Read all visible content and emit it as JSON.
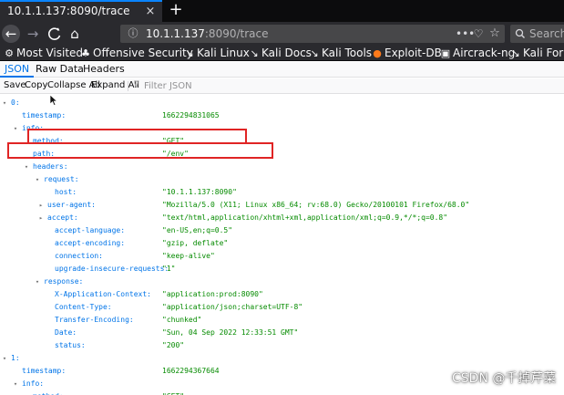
{
  "browser": {
    "tab_title": "10.1.1.137:8090/trace",
    "tab_close_glyph": "×",
    "new_tab_glyph": "+",
    "back_glyph": "←",
    "forward_glyph": "→",
    "reload_glyph": "C",
    "home_glyph": "⌂",
    "url_host": "10.1.1.137",
    "url_rest": ":8090/trace",
    "url_more_glyph": "•••",
    "url_pocket_glyph": "♡",
    "url_star_glyph": "☆",
    "search_placeholder": "Search",
    "accent": "#0a84ff"
  },
  "bookmarks": [
    {
      "label": "Most Visited",
      "icon": "gear-icon",
      "glyph": "⚙"
    },
    {
      "label": "Offensive Security",
      "icon": "offsec-icon",
      "glyph": "♣"
    },
    {
      "label": "Kali Linux",
      "icon": "kali-icon",
      "glyph": "↘"
    },
    {
      "label": "Kali Docs",
      "icon": "kali-icon",
      "glyph": "↘"
    },
    {
      "label": "Kali Tools",
      "icon": "kali-icon",
      "glyph": "↘"
    },
    {
      "label": "Exploit-DB",
      "icon": "exploitdb-icon",
      "glyph": "●"
    },
    {
      "label": "Aircrack-ng",
      "icon": "aircrack-icon",
      "glyph": "▣"
    },
    {
      "label": "Kali Foru",
      "icon": "kali-icon",
      "glyph": "↘"
    }
  ],
  "viewer": {
    "tabs": [
      "JSON",
      "Raw Data",
      "Headers"
    ],
    "toolbar": [
      "Save",
      "Copy",
      "Collapse All",
      "Expand All"
    ],
    "filter_glyph": "⊽",
    "filter_placeholder": "Filter JSON"
  },
  "json_rows": [
    {
      "twisty": "▾",
      "key": "0:",
      "value": ""
    },
    {
      "twisty": "",
      "key": "timestamp:",
      "value": "1662294831065"
    },
    {
      "twisty": "▾",
      "key": "info:",
      "value": ""
    },
    {
      "twisty": "",
      "key": "method:",
      "value": "\"GET\""
    },
    {
      "twisty": "",
      "key": "path:",
      "value": "\"/env\""
    },
    {
      "twisty": "▾",
      "key": "headers:",
      "value": ""
    },
    {
      "twisty": "▾",
      "key": "request:",
      "value": ""
    },
    {
      "twisty": "",
      "key": "host:",
      "value": "\"10.1.1.137:8090\""
    },
    {
      "twisty": "▸",
      "key": "user-agent:",
      "value": "\"Mozilla/5.0 (X11; Linux x86_64; rv:68.0) Gecko/20100101 Firefox/68.0\""
    },
    {
      "twisty": "▸",
      "key": "accept:",
      "value": "\"text/html,application/xhtml+xml,application/xml;q=0.9,*/*;q=0.8\""
    },
    {
      "twisty": "",
      "key": "accept-language:",
      "value": "\"en-US,en;q=0.5\""
    },
    {
      "twisty": "",
      "key": "accept-encoding:",
      "value": "\"gzip, deflate\""
    },
    {
      "twisty": "",
      "key": "connection:",
      "value": "\"keep-alive\""
    },
    {
      "twisty": "",
      "key": "upgrade-insecure-requests:",
      "value": "\"1\""
    },
    {
      "twisty": "▾",
      "key": "response:",
      "value": ""
    },
    {
      "twisty": "",
      "key": "X-Application-Context:",
      "value": "\"application:prod:8090\""
    },
    {
      "twisty": "",
      "key": "Content-Type:",
      "value": "\"application/json;charset=UTF-8\""
    },
    {
      "twisty": "",
      "key": "Transfer-Encoding:",
      "value": "\"chunked\""
    },
    {
      "twisty": "",
      "key": "Date:",
      "value": "\"Sun, 04 Sep 2022 12:33:51 GMT\""
    },
    {
      "twisty": "",
      "key": "status:",
      "value": "\"200\""
    },
    {
      "twisty": "▾",
      "key": "1:",
      "value": ""
    },
    {
      "twisty": "",
      "key": "timestamp:",
      "value": "1662294367664"
    },
    {
      "twisty": "▾",
      "key": "info:",
      "value": ""
    },
    {
      "twisty": "",
      "key": "method:",
      "value": "\"GET\""
    }
  ],
  "watermark": "CSDN @千掉芹菜",
  "colors": {
    "key": "#0074e8",
    "string": "#058b00",
    "highlight": "#e02424"
  }
}
